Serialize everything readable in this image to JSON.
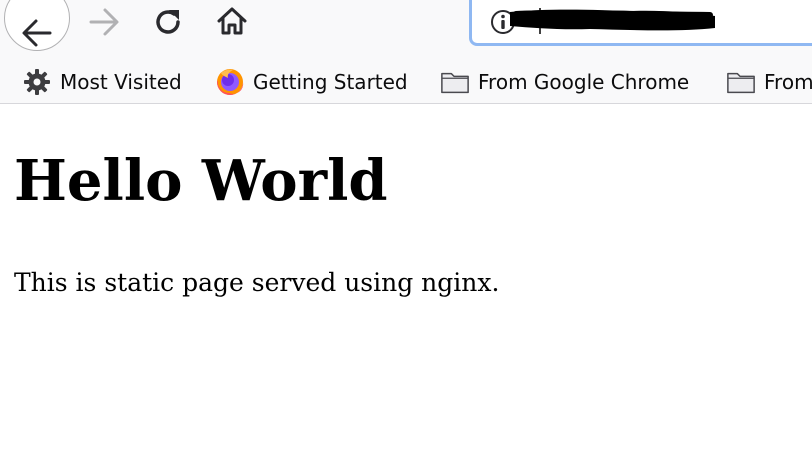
{
  "browser": {
    "accent_color": "#8fb8f2",
    "toolbar_bg": "#f9f9fa",
    "nav": {
      "back": "arrow-left-icon",
      "forward": "arrow-right-icon",
      "reload": "reload-icon",
      "home": "home-icon"
    },
    "url_bar": {
      "site_info_icon": "info-icon",
      "url_redacted": true
    },
    "bookmarks": [
      {
        "label": "Most Visited",
        "icon": "gear-icon"
      },
      {
        "label": "Getting Started",
        "icon": "firefox-icon"
      },
      {
        "label": "From Google Chrome",
        "icon": "folder-icon"
      },
      {
        "label": "From",
        "icon": "folder-icon"
      }
    ]
  },
  "page": {
    "heading": "Hello World",
    "paragraph": "This is static page served using nginx."
  }
}
